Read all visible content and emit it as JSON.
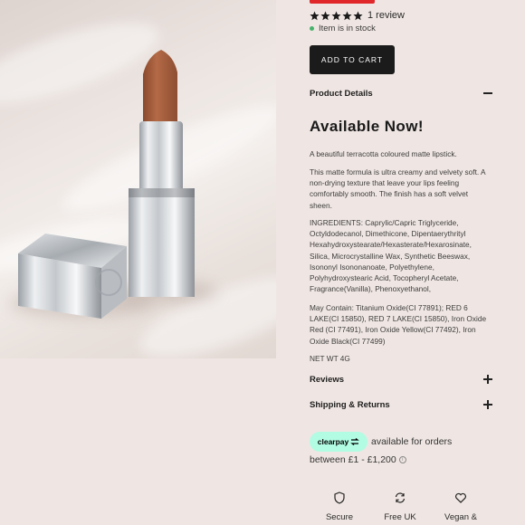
{
  "product": {
    "review_count": "1 review",
    "rating": 5,
    "stock_status": "Item is in stock",
    "add_to_cart": "ADD TO CART",
    "accent_color": "#e0282b"
  },
  "details": {
    "title": "Product Details",
    "heading": "Available Now!",
    "description": "A beautiful terracotta coloured matte lipstick.",
    "formula": "This matte formula is ultra creamy and velvety soft. A non-drying texture that leave your lips feeling comfortably smooth. The finish has a soft velvet sheen.",
    "ingredients": "INGREDIENTS: Caprylic/Capric Triglyceride, Octyldodecanol, Dimethicone, Dipentaerythrityl Hexahydroxystearate/Hexasterate/Hexarosinate, Silica, Microcrystalline Wax, Synthetic Beeswax, Isononyl Isononanoate, Polyethylene, Polyhydroxystearic Acid, Tocopheryl Acetate, Fragrance(Vanilla), Phenoxyethanol,",
    "may_contain": "May Contain: Titanium Oxide(CI 77891); RED 6 LAKE(CI 15850), RED 7 LAKE(CI 15850), Iron Oxide Red (CI 77491), Iron Oxide Yellow(CI 77492), Iron Oxide Black(CI 77499)",
    "net_weight": "NET WT 4G"
  },
  "accordions": {
    "reviews": "Reviews",
    "shipping": "Shipping & Returns"
  },
  "clearpay": {
    "brand": "clearpay",
    "text": "available for orders",
    "range": "between £1 - £1,200",
    "info": "i"
  },
  "features": [
    {
      "label": "Secure",
      "icon": "shield-icon"
    },
    {
      "label": "Free UK",
      "icon": "refresh-icon"
    },
    {
      "label": "Vegan &",
      "icon": "heart-icon"
    }
  ]
}
